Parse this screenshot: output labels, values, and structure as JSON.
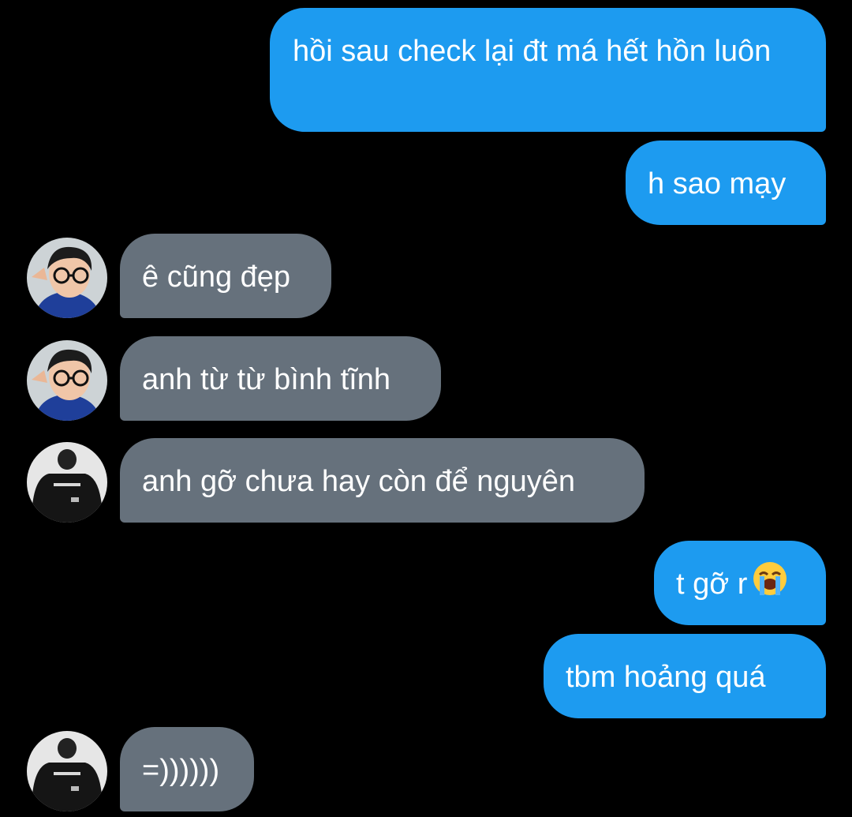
{
  "messages": [
    {
      "direction": "outgoing",
      "text": "hồi sau check lại đt má hết hồn luôn"
    },
    {
      "direction": "outgoing",
      "text": "h sao mạy"
    },
    {
      "direction": "incoming",
      "sender_avatar": "glasses-person-avatar",
      "text": "ê cũng đẹp"
    },
    {
      "direction": "incoming",
      "sender_avatar": "glasses-person-avatar",
      "text": "anh từ từ bình tĩnh"
    },
    {
      "direction": "incoming",
      "sender_avatar": "jersey-person-avatar",
      "text": "anh gỡ chưa hay còn để nguyên"
    },
    {
      "direction": "outgoing",
      "text": "t gỡ r",
      "emoji": "loudly-crying-face-icon"
    },
    {
      "direction": "outgoing",
      "text": "tbm hoảng quá"
    },
    {
      "direction": "incoming",
      "sender_avatar": "jersey-person-avatar",
      "text": "=))))))"
    }
  ],
  "colors": {
    "background": "#000000",
    "outgoing_bubble": "#1d9bf0",
    "incoming_bubble": "#66717c",
    "text": "#ffffff"
  }
}
